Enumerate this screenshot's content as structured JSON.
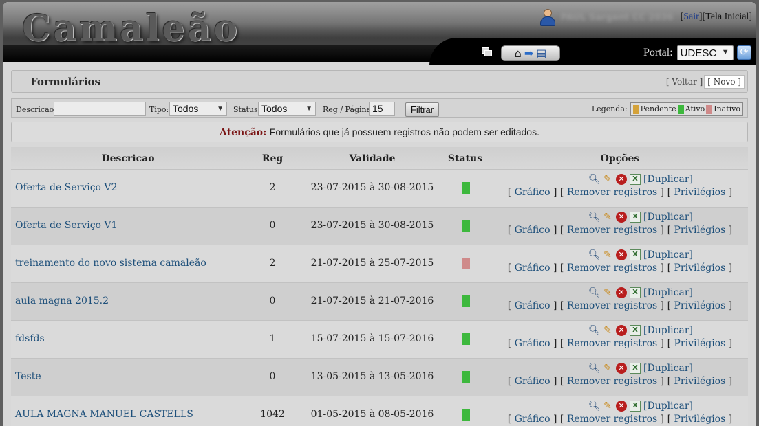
{
  "header": {
    "logo_text": "Camaleão",
    "user_name": "PAUL Sargent CC 2036",
    "sair": "Sair",
    "tela_inicial": "Tela Inicial",
    "portal_label": "Portal:",
    "portal_value": "UDESC"
  },
  "page": {
    "title": "Formulários",
    "voltar": "[ Voltar ]",
    "novo": "[ Novo ]"
  },
  "filters": {
    "descricao_label": "Descricao:",
    "descricao_value": "",
    "tipo_label": "Tipo:",
    "tipo_value": "Todos",
    "status_label": "Status:",
    "status_value": "Todos",
    "reg_label": "Reg / Página:",
    "reg_value": "15",
    "filtrar": "Filtrar",
    "legend_label": "Legenda:",
    "legend": [
      {
        "label": "Pendente",
        "color": "#d4a23a"
      },
      {
        "label": "Ativo",
        "color": "#3db83d"
      },
      {
        "label": "Inativo",
        "color": "#cf8a8a"
      }
    ]
  },
  "notice": {
    "attention": "Atenção:",
    "message": "Formulários que já possuem registros não podem ser editados."
  },
  "table": {
    "headers": {
      "descricao": "Descricao",
      "reg": "Reg",
      "validade": "Validade",
      "status": "Status",
      "opcoes": "Opções"
    },
    "ops": {
      "duplicar": "[Duplicar]",
      "grafico": "Gráfico",
      "remover": "Remover registros",
      "privilegios": "Privilégios"
    },
    "rows": [
      {
        "descricao": "Oferta de Serviço V2",
        "reg": "2",
        "validade": "23-07-2015 à 30-08-2015",
        "status": "ativo"
      },
      {
        "descricao": "Oferta de Serviço V1",
        "reg": "0",
        "validade": "23-07-2015 à 30-08-2015",
        "status": "ativo"
      },
      {
        "descricao": "treinamento do novo sistema camaleão",
        "reg": "2",
        "validade": "21-07-2015 à 25-07-2015",
        "status": "inativo"
      },
      {
        "descricao": "aula magna 2015.2",
        "reg": "0",
        "validade": "21-07-2015 à 21-07-2016",
        "status": "ativo"
      },
      {
        "descricao": "fdsfds",
        "reg": "1",
        "validade": "15-07-2015 à 15-07-2016",
        "status": "ativo"
      },
      {
        "descricao": "Teste",
        "reg": "0",
        "validade": "13-05-2015 à 13-05-2016",
        "status": "ativo"
      },
      {
        "descricao": "AULA MAGNA MANUEL CASTELLS",
        "reg": "1042",
        "validade": "01-05-2015 à 08-05-2016",
        "status": "ativo"
      }
    ]
  },
  "colors": {
    "ativo": "#3db83d",
    "inativo": "#cf8a8a",
    "pendente": "#d4a23a"
  }
}
